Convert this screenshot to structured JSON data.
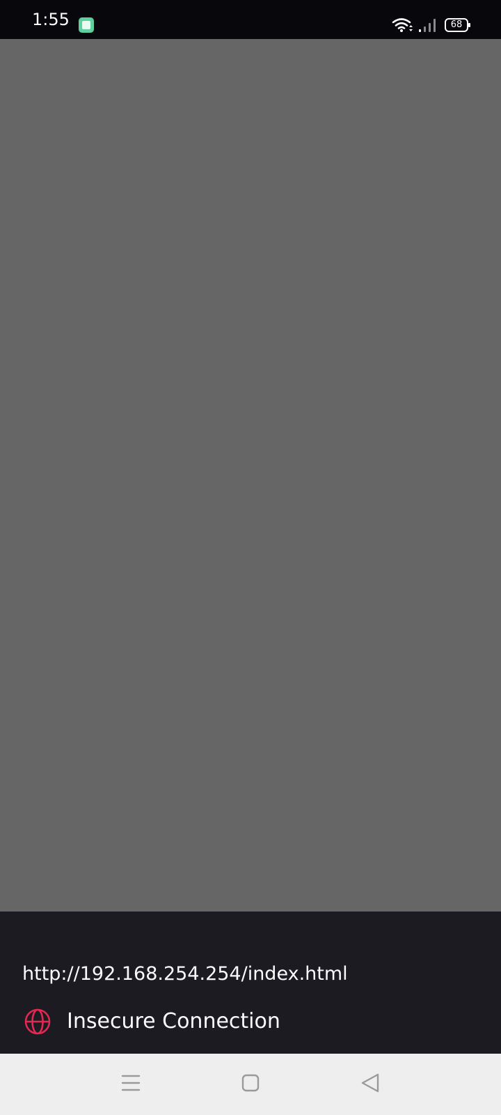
{
  "status_bar": {
    "time": "1:55",
    "battery_level": "68",
    "icons": [
      "app-notification-icon",
      "wifi-icon",
      "signal-icon",
      "battery-icon"
    ]
  },
  "site_info": {
    "url": "http://192.168.254.254/index.html",
    "security_label": "Insecure Connection",
    "security_icon": "globe-icon"
  },
  "nav_bar": {
    "icons": [
      "menu-icon",
      "home-icon",
      "back-icon"
    ]
  },
  "colors": {
    "status_bar_bg": "#08080c",
    "page_overlay": "#666666",
    "panel_bg": "#1c1b22",
    "insecure_red": "#e22850",
    "app_icon_green": "#5fcf9f",
    "nav_bar_bg": "#eeeeee"
  }
}
